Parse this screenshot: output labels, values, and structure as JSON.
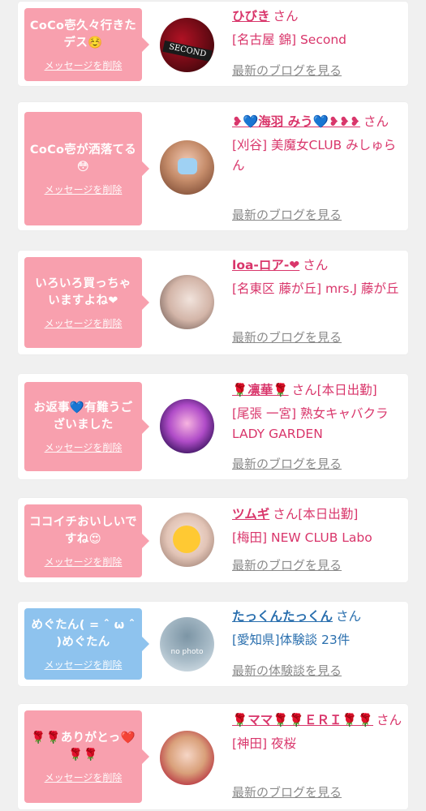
{
  "colors": {
    "pink_bubble": "#f8a0ae",
    "blue_bubble": "#8ec3ee",
    "name_pink": "#d9366b",
    "name_blue": "#2a6fae"
  },
  "items": [
    {
      "message": "CoCo壱久々行きたデス☺️",
      "delete_label": "メッセージを削除",
      "name": "ひびき",
      "san": "さん",
      "shop": "[名古屋 錦] Second",
      "latest": "最新のブログを見る"
    },
    {
      "message": "CoCo壱が洒落てる😳",
      "delete_label": "メッセージを削除",
      "name": "❥💙海羽 みう💙❥❥❥",
      "san": "さん",
      "shop": "[刈谷] 美魔女CLUB みしゅらん",
      "latest": "最新のブログを見る"
    },
    {
      "message": "いろいろ買っちゃいますよね❤",
      "delete_label": "メッセージを削除",
      "name": "loa-ロア-❤",
      "san": "さん",
      "shop": "[名東区 藤が丘] mrs.J 藤が丘",
      "latest": "最新のブログを見る"
    },
    {
      "message": "お返事💙有難うございました",
      "delete_label": "メッセージを削除",
      "name": "🌹凛華🌹",
      "san": "さん[本日出勤]",
      "shop": "[尾張 一宮] 熟女キャバクラ LADY GARDEN",
      "latest": "最新のブログを見る"
    },
    {
      "message": "ココイチおいしいですね😍",
      "delete_label": "メッセージを削除",
      "name": "ツムギ",
      "san": "さん[本日出勤]",
      "shop": "[梅田] NEW CLUB Labo",
      "latest": "最新のブログを見る"
    },
    {
      "message": "めぐたん( = ˆ ω ˆ )めぐたん",
      "delete_label": "メッセージを削除",
      "name": "たっくんたっくん",
      "san": "さん",
      "shop": "[愛知県]体験談 23件",
      "latest": "最新の体験談を見る",
      "avatar_text": "no photo"
    },
    {
      "message": "🌹🌹ありがとっ❤️🌹🌹",
      "delete_label": "メッセージを削除",
      "name": "🌹ママ🌹🌹ＥＲＩ🌹🌹",
      "san": "さん",
      "shop": "[神田] 夜桜",
      "latest": "最新のブログを見る"
    }
  ]
}
